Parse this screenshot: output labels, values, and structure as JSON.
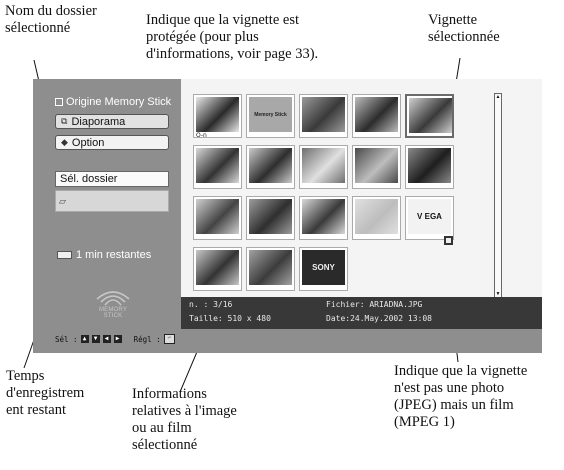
{
  "annotations": {
    "folder_name": "Nom du dossier\nsélectionné",
    "protected": "Indique que la vignette est\nprotégée (pour plus\nd'informations, voir page 33).",
    "selected_thumb": "Vignette\nsélectionnée",
    "movie_marker": "Indique que la vignette\nn'est pas une photo\n(JPEG) mais un film\n(MPEG 1)",
    "image_info": "Informations\nrelatives à l'image\nou au film\nsélectionné",
    "time_left": "Temps\nd'enregistrem\nent restant"
  },
  "left_panel": {
    "source_label": "Origine Memory Stick",
    "menu": [
      {
        "label": "Diaporama",
        "icon": "slideshow-icon"
      },
      {
        "label": "Option",
        "icon": "option-icon"
      }
    ],
    "folder_button": "Sél. dossier",
    "folder_field_icon": "folder-icon",
    "time_remaining": "1 min restantes",
    "logo_text": "MEMORY STICK",
    "help": {
      "select_label": "Sél :",
      "settings_label": "Régl :"
    }
  },
  "thumbnails": [
    {
      "name": "thumb-people-outdoor",
      "protected": true,
      "protected_glyph": "O-n",
      "selected": false,
      "movie": false,
      "colors": [
        "#e8e8e8",
        "#2a2a2a"
      ]
    },
    {
      "name": "thumb-memory-stick-card",
      "protected": false,
      "selected": false,
      "movie": false,
      "colors": [
        "#a8a8a8",
        "#222222"
      ],
      "text": "Memory Stick"
    },
    {
      "name": "thumb-crowd",
      "protected": false,
      "selected": false,
      "movie": false,
      "colors": [
        "#9a9a9a",
        "#3a3a3a"
      ]
    },
    {
      "name": "thumb-mountain",
      "protected": false,
      "selected": false,
      "movie": false,
      "colors": [
        "#bcbcbc",
        "#2c2c2c"
      ]
    },
    {
      "name": "thumb-portrait-girl",
      "protected": false,
      "selected": true,
      "movie": false,
      "colors": [
        "#cfcfcf",
        "#3a3a3a"
      ]
    },
    {
      "name": "thumb-couple-1",
      "protected": false,
      "selected": false,
      "movie": false,
      "colors": [
        "#d8d8d8",
        "#333333"
      ]
    },
    {
      "name": "thumb-couple-2",
      "protected": false,
      "selected": false,
      "movie": false,
      "colors": [
        "#cacaca",
        "#2e2e2e"
      ]
    },
    {
      "name": "thumb-landscape-1",
      "protected": false,
      "selected": false,
      "movie": false,
      "colors": [
        "#6e6e6e",
        "#e0e0e0"
      ]
    },
    {
      "name": "thumb-landscape-2",
      "protected": false,
      "selected": false,
      "movie": false,
      "colors": [
        "#4a4a4a",
        "#bdbdbd"
      ]
    },
    {
      "name": "thumb-rocks",
      "protected": false,
      "selected": false,
      "movie": false,
      "colors": [
        "#8a8a8a",
        "#1e1e1e"
      ]
    },
    {
      "name": "thumb-kids",
      "protected": false,
      "selected": false,
      "movie": false,
      "colors": [
        "#d0d0d0",
        "#444444"
      ]
    },
    {
      "name": "thumb-building",
      "protected": false,
      "selected": false,
      "movie": false,
      "colors": [
        "#9c9c9c",
        "#2f2f2f"
      ]
    },
    {
      "name": "thumb-sea-rock",
      "protected": false,
      "selected": false,
      "movie": false,
      "colors": [
        "#d9d9d9",
        "#3a3a3a"
      ]
    },
    {
      "name": "thumb-flowers",
      "protected": false,
      "selected": false,
      "movie": false,
      "colors": [
        "#e0e0e0",
        "#bdbdbd"
      ]
    },
    {
      "name": "thumb-vega-logo",
      "protected": false,
      "selected": false,
      "movie": true,
      "colors": [
        "#f2f2f2",
        "#111111"
      ],
      "text": "V EGA"
    },
    {
      "name": "thumb-coast",
      "protected": false,
      "selected": false,
      "movie": false,
      "colors": [
        "#c8c8c8",
        "#333333"
      ]
    },
    {
      "name": "thumb-trees",
      "protected": false,
      "selected": false,
      "movie": false,
      "colors": [
        "#a2a2a2",
        "#3c3c3c"
      ]
    },
    {
      "name": "thumb-sony-logo",
      "protected": false,
      "selected": false,
      "movie": false,
      "colors": [
        "#2a2a2a",
        "#eeeeee"
      ],
      "text": "SONY"
    }
  ],
  "info": {
    "index_label": "n. : 3/16",
    "file_label": "Fichier: ARIADNA.JPG",
    "size_label": "Taille: 510 x 480",
    "date_label": "Date:24.May.2002 13:08"
  },
  "colors": {
    "screen_bg": "#8e8e8e",
    "grid_bg": "#f4f4f4",
    "info_bg": "#383838"
  }
}
